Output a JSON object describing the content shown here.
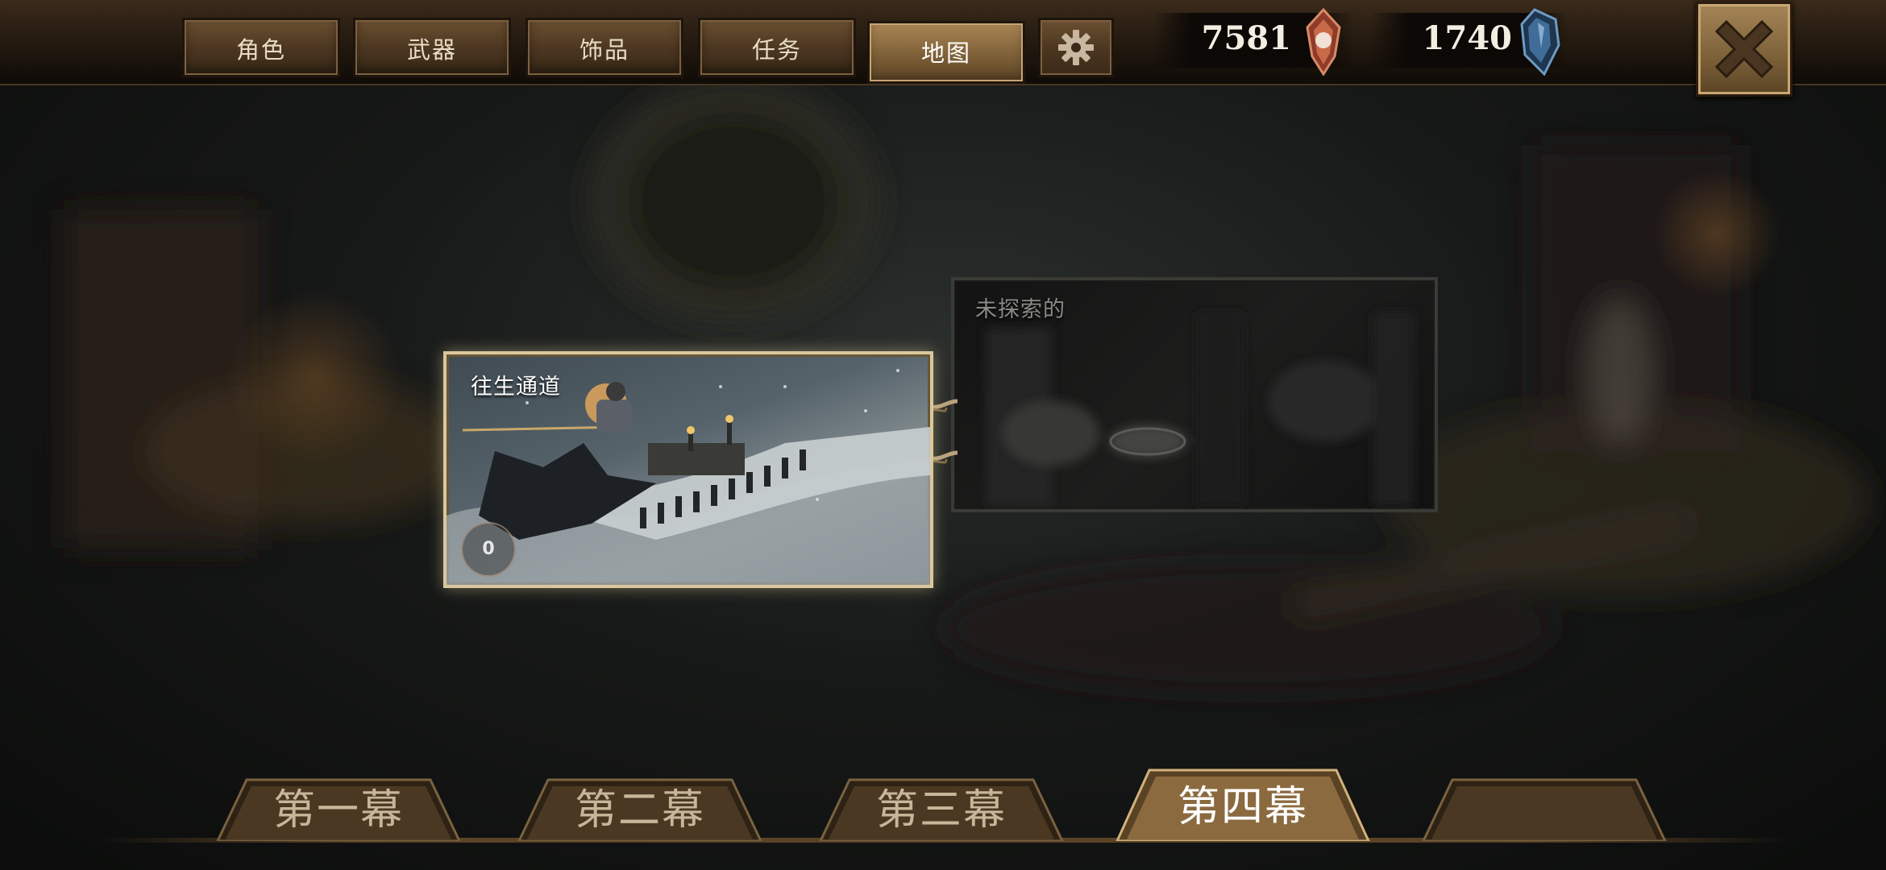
{
  "nav": {
    "tabs": [
      {
        "label": "角色"
      },
      {
        "label": "武器"
      },
      {
        "label": "饰品"
      },
      {
        "label": "任务"
      },
      {
        "label": "地图",
        "active": true
      }
    ],
    "settings_icon": "gear-icon"
  },
  "currency": {
    "red_gem": {
      "value": "7581",
      "icon": "red-soul-gem-icon"
    },
    "blue_crystal": {
      "value": "1740",
      "icon": "blue-crystal-icon"
    }
  },
  "close_icon": "close-icon",
  "map": {
    "explored_area": {
      "title": "往生通道",
      "counter": "0"
    },
    "unexplored_area": {
      "title": "未探索的"
    }
  },
  "chapters": [
    {
      "label": "第一幕"
    },
    {
      "label": "第二幕"
    },
    {
      "label": "第三幕"
    },
    {
      "label": "第四幕",
      "active": true
    },
    {
      "label": ""
    }
  ],
  "colors": {
    "accent_gold": "#d9c79e",
    "tab_brown": "#4a3520",
    "active_tab": "#a98554"
  }
}
